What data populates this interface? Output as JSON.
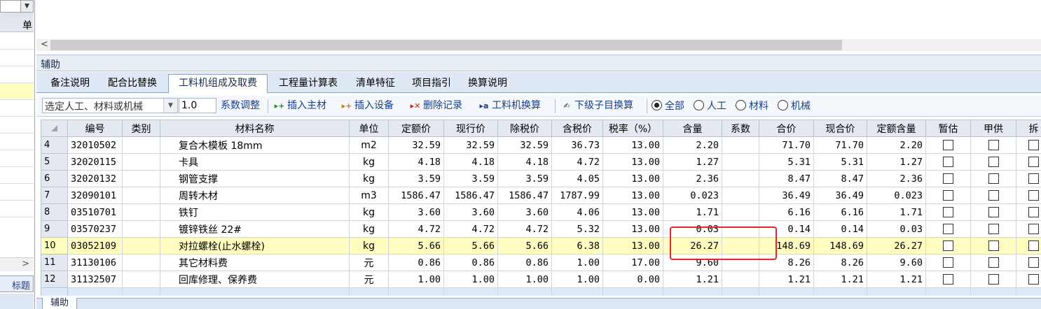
{
  "left_panel": {
    "header_label": "单",
    "tab_label": "标题",
    "scroll_arrow": ">"
  },
  "top_scroll": {
    "arrow": "<"
  },
  "panel": {
    "title": "辅助"
  },
  "tabs": [
    {
      "label": "备注说明",
      "active": false
    },
    {
      "label": "配合比替换",
      "active": false
    },
    {
      "label": "工料机组成及取费",
      "active": true
    },
    {
      "label": "工程量计算表",
      "active": false
    },
    {
      "label": "清单特征",
      "active": false
    },
    {
      "label": "项目指引",
      "active": false
    },
    {
      "label": "换算说明",
      "active": false
    }
  ],
  "toolbar": {
    "select_value": "选定人工、材料或机械",
    "coef_value": "1.0",
    "coef_adjust": "系数调整",
    "insert_main": "插入主材",
    "insert_equip": "插入设备",
    "delete_record": "删除记录",
    "labor_convert": "工料机换算",
    "sub_convert": "下级子目换算",
    "filters": [
      {
        "label": "全部",
        "checked": true
      },
      {
        "label": "人工",
        "checked": false
      },
      {
        "label": "材料",
        "checked": false
      },
      {
        "label": "机械",
        "checked": false
      }
    ]
  },
  "grid": {
    "columns": [
      "编号",
      "类别",
      "材料名称",
      "单位",
      "定额价",
      "现行价",
      "除税价",
      "含税价",
      "税率（%）",
      "含量",
      "系数",
      "合价",
      "现合价",
      "定额含量",
      "暂估",
      "甲供",
      "拆"
    ],
    "rows": [
      {
        "n": "4",
        "code": "32010502",
        "cat": "",
        "name": "复合木模板 18mm",
        "unit": "m2",
        "quota": "32.59",
        "current": "32.59",
        "extax": "32.59",
        "inctax": "36.73",
        "rate": "13.00",
        "qty": "2.20",
        "coef": "",
        "total": "71.70",
        "cur_total": "71.70",
        "quota_qty": "2.20"
      },
      {
        "n": "5",
        "code": "32020115",
        "cat": "",
        "name": "卡具",
        "unit": "kg",
        "quota": "4.18",
        "current": "4.18",
        "extax": "4.18",
        "inctax": "4.72",
        "rate": "13.00",
        "qty": "1.27",
        "coef": "",
        "total": "5.31",
        "cur_total": "5.31",
        "quota_qty": "1.27"
      },
      {
        "n": "6",
        "code": "32020132",
        "cat": "",
        "name": "钢管支撑",
        "unit": "kg",
        "quota": "3.59",
        "current": "3.59",
        "extax": "3.59",
        "inctax": "4.05",
        "rate": "13.00",
        "qty": "2.36",
        "coef": "",
        "total": "8.47",
        "cur_total": "8.47",
        "quota_qty": "2.36"
      },
      {
        "n": "7",
        "code": "32090101",
        "cat": "",
        "name": "周转木材",
        "unit": "m3",
        "quota": "1586.47",
        "current": "1586.47",
        "extax": "1586.47",
        "inctax": "1787.99",
        "rate": "13.00",
        "qty": "0.023",
        "coef": "",
        "total": "36.49",
        "cur_total": "36.49",
        "quota_qty": "0.023"
      },
      {
        "n": "8",
        "code": "03510701",
        "cat": "",
        "name": "铁钉",
        "unit": "kg",
        "quota": "3.60",
        "current": "3.60",
        "extax": "3.60",
        "inctax": "4.06",
        "rate": "13.00",
        "qty": "1.71",
        "coef": "",
        "total": "6.16",
        "cur_total": "6.16",
        "quota_qty": "1.71"
      },
      {
        "n": "9",
        "code": "03570237",
        "cat": "",
        "name": "镀锌铁丝 22#",
        "unit": "kg",
        "quota": "4.72",
        "current": "4.72",
        "extax": "4.72",
        "inctax": "5.32",
        "rate": "13.00",
        "qty": "0.03",
        "coef": "",
        "total": "0.14",
        "cur_total": "0.14",
        "quota_qty": "0.03"
      },
      {
        "n": "10",
        "code": "03052109",
        "cat": "",
        "name": "对拉螺栓(止水螺栓)",
        "unit": "kg",
        "quota": "5.66",
        "current": "5.66",
        "extax": "5.66",
        "inctax": "6.38",
        "rate": "13.00",
        "qty": "26.27",
        "coef": "",
        "total": "148.69",
        "cur_total": "148.69",
        "quota_qty": "26.27"
      },
      {
        "n": "11",
        "code": "31130106",
        "cat": "",
        "name": "其它材料费",
        "unit": "元",
        "quota": "0.86",
        "current": "0.86",
        "extax": "0.86",
        "inctax": "1.00",
        "rate": "17.00",
        "qty": "9.60",
        "coef": "",
        "total": "8.26",
        "cur_total": "8.26",
        "quota_qty": "9.60"
      },
      {
        "n": "12",
        "code": "31132507",
        "cat": "",
        "name": "回库修理、保养费",
        "unit": "元",
        "quota": "1.00",
        "current": "1.00",
        "extax": "1.00",
        "inctax": "1.00",
        "rate": "0.00",
        "qty": "1.21",
        "coef": "",
        "total": "1.21",
        "cur_total": "1.21",
        "quota_qty": "1.21"
      }
    ],
    "selected_row": "10"
  },
  "bottom": {
    "tab_label": "辅助"
  },
  "colors": {
    "selected_row": "#fffcbf",
    "highlight": "#e5252a",
    "header_bg": "#e4e9f1",
    "link_text": "#1a3f8a"
  }
}
